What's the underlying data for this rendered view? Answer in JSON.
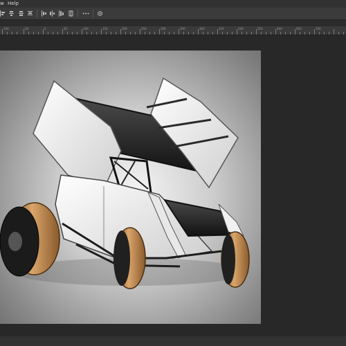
{
  "menu": {
    "partial_item": "w",
    "help": "Help"
  },
  "options_bar": {
    "icons": [
      "align-left-edges-icon",
      "align-horizontal-centers-icon",
      "align-right-edges-icon",
      "align-top-edges-icon",
      "align-vertical-centers-icon",
      "align-bottom-edges-icon",
      "distribute-top-icon",
      "distribute-vertical-centers-icon",
      "distribute-bottom-icon",
      "distribute-left-icon",
      "more-options-icon",
      "settings-gear-icon"
    ]
  },
  "ruler": {
    "labels": [
      "100",
      "50",
      "0",
      "50",
      "100",
      "150",
      "200",
      "250",
      "300",
      "350",
      "400",
      "450",
      "500",
      "550",
      "600",
      "650",
      "700"
    ]
  },
  "canvas": {
    "image_subject": "sprint car with wings",
    "background": "#f0f0f0"
  },
  "colors": {
    "app_bg": "#282828",
    "menubar": "#323232",
    "options_bar": "#3b3b3b",
    "ruler": "#3a3a3a"
  }
}
